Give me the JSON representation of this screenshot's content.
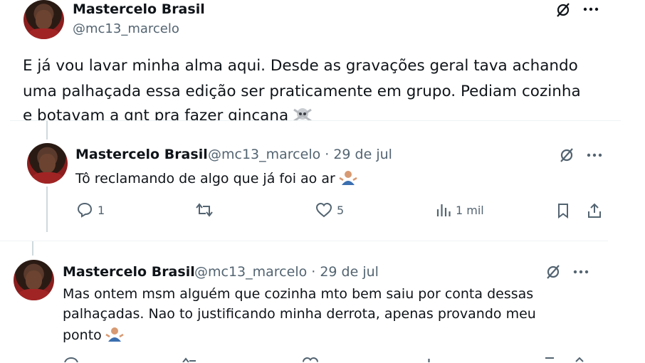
{
  "main_tweet": {
    "author_name": "Mastercelo Brasil",
    "author_handle": "@mc13_marcelo",
    "text_line1": "E já vou lavar minha alma aqui. Desde as gravações geral tava achando",
    "text_line2": "uma palhaçada essa edição ser praticamente em grupo. Pediam cozinha",
    "text_line3": "e botavam a gnt pra fazer gincana"
  },
  "reply1": {
    "author_name": "Mastercelo Brasil",
    "author_handle": "@mc13_marcelo · 29 de jul",
    "text": "Tô reclamando de algo que já foi ao ar",
    "replies": "1",
    "likes": "5",
    "views": "1 mil"
  },
  "reply2": {
    "author_name": "Mastercelo Brasil",
    "author_handle": "@mc13_marcelo · 29 de jul",
    "text_line1": "Mas ontem msm alguém que cozinha mto bem saiu por conta dessas",
    "text_line2": "palhaçadas. Nao to justificando minha derrota, apenas provando meu",
    "text_line3": "ponto"
  },
  "icons": {
    "grok": "grok-icon",
    "more": "more-icon",
    "reply": "reply-icon",
    "retweet": "retweet-icon",
    "like": "like-icon",
    "views": "views-icon",
    "bookmark": "bookmark-icon",
    "share": "share-icon"
  },
  "colors": {
    "text": "#0f1419",
    "secondary": "#536471",
    "thread_line": "#cfd9de"
  }
}
